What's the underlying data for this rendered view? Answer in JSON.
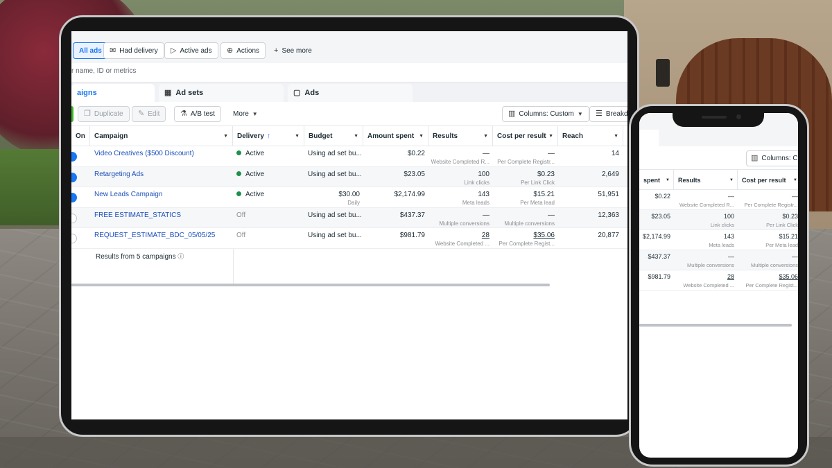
{
  "filters": {
    "all_ads": "All ads",
    "had_delivery": "Had delivery",
    "active_ads": "Active ads",
    "actions": "Actions",
    "see_more": "See more"
  },
  "search": {
    "placeholder": "r name, ID or metrics"
  },
  "tabs": {
    "campaigns": "aigns",
    "ad_sets": "Ad sets",
    "ads": "Ads"
  },
  "toolbar": {
    "duplicate": "Duplicate",
    "edit": "Edit",
    "ab_test": "A/B test",
    "more": "More",
    "columns": "Columns: Custom",
    "breakdown": "Breakd"
  },
  "columns": {
    "on": "On",
    "campaign": "Campaign",
    "delivery": "Delivery",
    "delivery_sort": "↑",
    "budget": "Budget",
    "amount_spent": "Amount spent",
    "results": "Results",
    "cost_per_result": "Cost per result",
    "reach": "Reach"
  },
  "rows": [
    {
      "toggle": "on",
      "campaign": "Video Creatives ($500 Discount)",
      "delivery": "Active",
      "delivery_active": true,
      "budget": "Using ad set bu...",
      "budget_sub": "",
      "amount": "$0.22",
      "results": "—",
      "results_sub": "Website Completed R...",
      "cpr": "—",
      "cpr_sub": "Per Complete Registr...",
      "reach": "14"
    },
    {
      "toggle": "on",
      "campaign": "Retargeting Ads",
      "delivery": "Active",
      "delivery_active": true,
      "budget": "Using ad set bu...",
      "budget_sub": "",
      "amount": "$23.05",
      "results": "100",
      "results_sub": "Link clicks",
      "cpr": "$0.23",
      "cpr_sub": "Per Link Click",
      "reach": "2,649"
    },
    {
      "toggle": "on",
      "campaign": "New Leads Campaign",
      "delivery": "Active",
      "delivery_active": true,
      "budget": "$30.00",
      "budget_sub": "Daily",
      "amount": "$2,174.99",
      "results": "143",
      "results_sub": "Meta leads",
      "cpr": "$15.21",
      "cpr_sub": "Per Meta lead",
      "reach": "51,951"
    },
    {
      "toggle": "off",
      "campaign": "FREE ESTIMATE_STATICS",
      "delivery": "Off",
      "delivery_active": false,
      "budget": "Using ad set bu...",
      "budget_sub": "",
      "amount": "$437.37",
      "results": "—",
      "results_sub": "Multiple conversions",
      "cpr": "—",
      "cpr_sub": "Multiple conversions",
      "reach": "12,363"
    },
    {
      "toggle": "off",
      "campaign": "REQUEST_ESTIMATE_BDC_05/05/25",
      "delivery": "Off",
      "delivery_active": false,
      "budget": "Using ad set bu...",
      "budget_sub": "",
      "amount": "$981.79",
      "results": "28",
      "results_sub": "Website Completed ...",
      "cpr": "$35.06",
      "cpr_sub": "Per Complete Regist...",
      "reach": "20,877"
    }
  ],
  "footer": {
    "summary": "Results from 5 campaigns",
    "info_icon": "info-icon"
  },
  "phone": {
    "columns_button": "Columns: Cu",
    "col_spent": "spent",
    "col_results": "Results",
    "col_cpr": "Cost per result",
    "rows": [
      {
        "amount": "$0.22",
        "results": "—",
        "results_sub": "Website Completed R...",
        "cpr": "—",
        "cpr_sub": "Per Complete Registr..."
      },
      {
        "amount": "$23.05",
        "results": "100",
        "results_sub": "Link clicks",
        "cpr": "$0.23",
        "cpr_sub": "Per Link Click"
      },
      {
        "amount": "$2,174.99",
        "results": "143",
        "results_sub": "Meta leads",
        "cpr": "$15.21",
        "cpr_sub": "Per Meta lead"
      },
      {
        "amount": "$437.37",
        "results": "—",
        "results_sub": "Multiple conversions",
        "cpr": "—",
        "cpr_sub": "Multiple conversions"
      },
      {
        "amount": "$981.79",
        "results": "28",
        "results_sub": "Website Completed ...",
        "cpr": "$35.06",
        "cpr_sub": "Per Complete Regist..."
      }
    ]
  },
  "colors": {
    "accent": "#1877f2",
    "active_dot": "#1e8f4e",
    "link": "#1b4fb9"
  }
}
